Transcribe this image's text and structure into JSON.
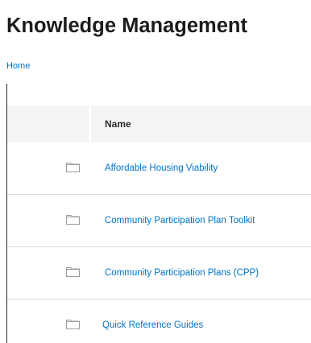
{
  "page": {
    "title": "Knowledge Management"
  },
  "breadcrumb": {
    "home": "Home"
  },
  "table": {
    "header_name": "Name",
    "rows": [
      {
        "name": "Affordable Housing Viability",
        "icon": "folder-icon"
      },
      {
        "name": "Community Participation Plan Toolkit",
        "icon": "folder-icon"
      },
      {
        "name": "Community Participation Plans (CPP)",
        "icon": "folder-icon"
      },
      {
        "name": "Quick Reference Guides",
        "icon": "folder-icon"
      }
    ]
  },
  "colors": {
    "link": "#0072c6",
    "title": "#1c1c1c",
    "header_bg": "#f4f4f4",
    "row_divider": "#dcdcdc"
  }
}
